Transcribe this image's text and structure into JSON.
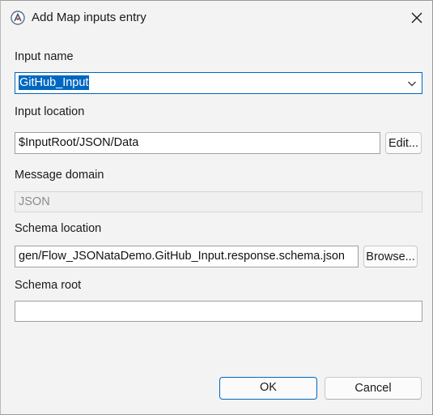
{
  "window": {
    "title": "Add Map inputs entry",
    "app_icon": "app-logo-icon",
    "close_icon": "close-icon"
  },
  "input_name": {
    "label": "Input name",
    "value": "GitHub_Input",
    "dropdown_icon": "chevron-down-icon"
  },
  "input_location": {
    "label": "Input location",
    "value": "$InputRoot/JSON/Data",
    "edit_button": "Edit..."
  },
  "message_domain": {
    "label": "Message domain",
    "value": "JSON"
  },
  "schema_location": {
    "label": "Schema location",
    "value": "gen/Flow_JSONataDemo.GitHub_Input.response.schema.json",
    "browse_button": "Browse..."
  },
  "schema_root": {
    "label": "Schema root",
    "value": ""
  },
  "footer": {
    "ok_label": "OK",
    "cancel_label": "Cancel"
  },
  "colors": {
    "accent": "#0067c0",
    "background": "#f3f3f3"
  }
}
